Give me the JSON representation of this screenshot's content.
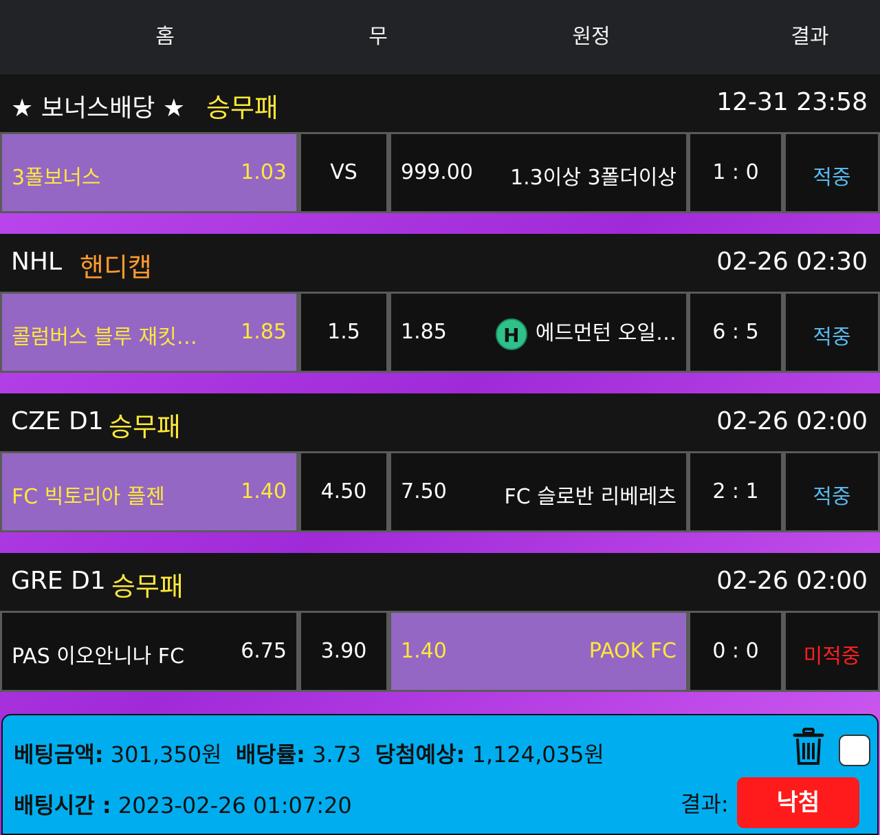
{
  "header": {
    "home": "홈",
    "draw": "무",
    "away": "원정",
    "result": "결과"
  },
  "matches": [
    {
      "league": "★ 보너스배당 ★",
      "bet_type": "승무패",
      "bet_type_color": "#ffe83a",
      "datetime": "12-31 23:58",
      "home_name": "3폴보너스",
      "home_odds": "1.03",
      "draw": "VS",
      "away_odds": "999.00",
      "away_name": "1.3이상 3폴더이상",
      "score": "1 : 0",
      "result": "적중",
      "selected": "home"
    },
    {
      "league": "NHL",
      "bet_type": "핸디캡",
      "bet_type_color": "#ff9a2e",
      "datetime": "02-26 02:30",
      "home_name": "콜럼버스 블루 재킷…",
      "home_odds": "1.85",
      "draw": "1.5",
      "away_odds": "1.85",
      "away_badge": "H",
      "away_name": "에드먼턴 오일…",
      "score": "6 : 5",
      "result": "적중",
      "selected": "home"
    },
    {
      "league": "CZE D1",
      "bet_type": "승무패",
      "bet_type_color": "#ffe83a",
      "datetime": "02-26 02:00",
      "home_name": "FC 빅토리아 플젠",
      "home_odds": "1.40",
      "draw": "4.50",
      "away_odds": "7.50",
      "away_name": "FC 슬로반 리베레츠",
      "score": "2 : 1",
      "result": "적중",
      "selected": "home"
    },
    {
      "league": "GRE D1",
      "bet_type": "승무패",
      "bet_type_color": "#ffe83a",
      "datetime": "02-26 02:00",
      "home_name": "PAS 이오안니나 FC",
      "home_odds": "6.75",
      "draw": "3.90",
      "away_odds": "1.40",
      "away_name": "PAOK FC",
      "score": "0 : 0",
      "result": "미적중",
      "selected": "away"
    }
  ],
  "summary": {
    "amount_label": "베팅금액:",
    "amount_value": "301,350원",
    "rate_label": "배당률:",
    "rate_value": "3.73",
    "expected_label": "당첨예상:",
    "expected_value": "1,124,035원",
    "time_label": "배팅시간 :",
    "time_value": "2023-02-26 01:07:20",
    "result_label": "결과:",
    "result_value": "낙첨"
  },
  "colors": {
    "selected_cell": "#9467c4",
    "hit": "#59b9ee",
    "miss": "#ff2020",
    "summary_bg": "#00aef0",
    "lose_button": "#ff1b1b"
  }
}
